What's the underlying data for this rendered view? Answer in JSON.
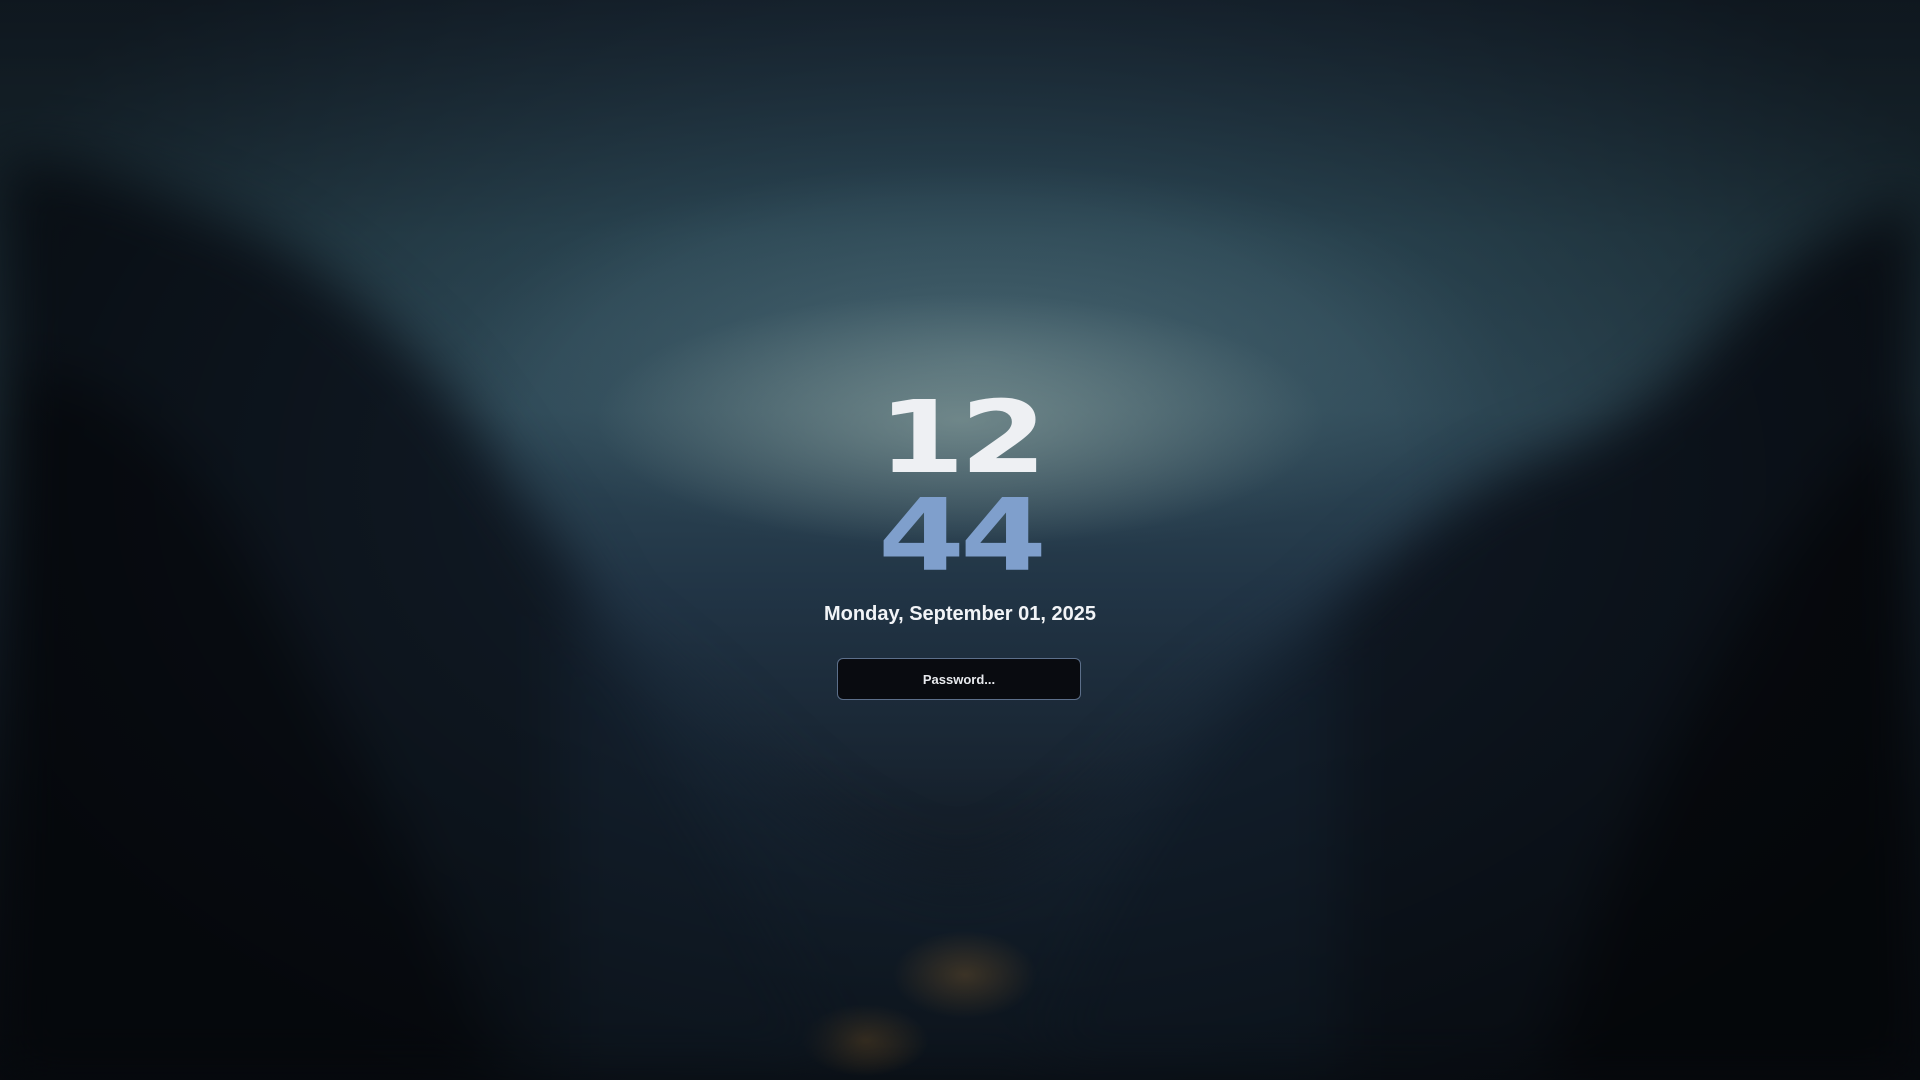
{
  "lockscreen": {
    "clock": {
      "hours": "12",
      "minutes": "44"
    },
    "date": "Monday, September 01, 2025",
    "password": {
      "value": "",
      "placeholder": "Password..."
    }
  },
  "colors": {
    "hours_text": "#eef0f3",
    "minutes_text": "#7f9fcc",
    "input_background": "#090b10",
    "input_border": "#5c6f8a"
  },
  "wallpaper": {
    "description_icon": "blurred-mountain-valley-wallpaper"
  }
}
